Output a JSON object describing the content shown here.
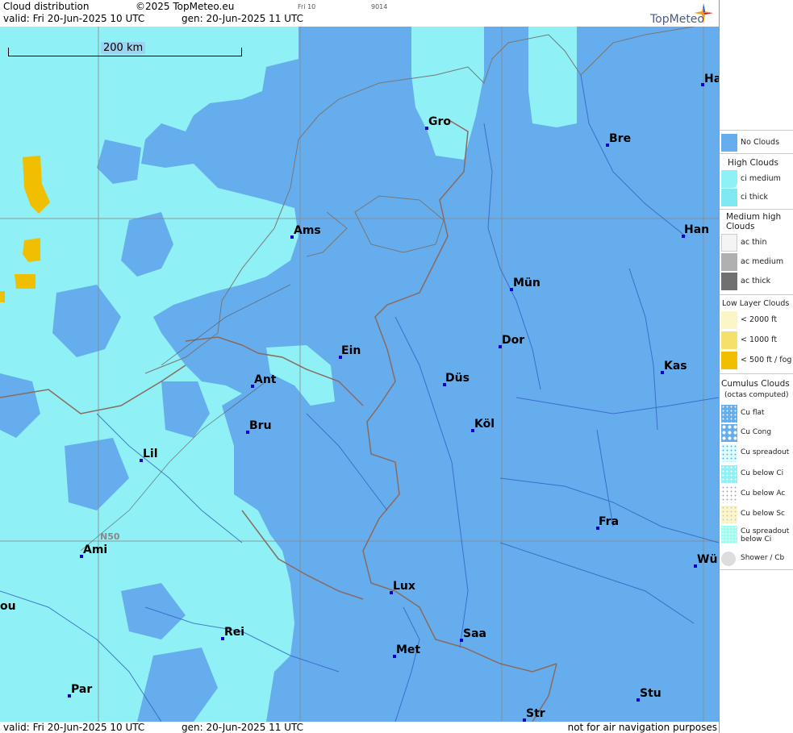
{
  "header": {
    "title": "Cloud distribution",
    "copyright": "©2025 TopMeteo.eu",
    "valid": "valid:  Fri  20-Jun-2025  10 UTC",
    "gen": "gen: 20-Jun-2025 11 UTC",
    "small1": "Fri 10",
    "small2": "9014",
    "logo": "TopMeteo"
  },
  "footer": {
    "valid": "valid:  Fri  20-Jun-2025  10 UTC",
    "gen": "gen: 20-Jun-2025 11 UTC",
    "note": "not for air navigation purposes"
  },
  "map": {
    "scale_label": "200 km",
    "lat_label": "N50",
    "cities": [
      {
        "name": "Ha"
      },
      {
        "name": "Gro"
      },
      {
        "name": "Bre"
      },
      {
        "name": "Ams"
      },
      {
        "name": "Han"
      },
      {
        "name": "Mün"
      },
      {
        "name": "Dor"
      },
      {
        "name": "Ein"
      },
      {
        "name": "Kas"
      },
      {
        "name": "Ant"
      },
      {
        "name": "Düs"
      },
      {
        "name": "Köl"
      },
      {
        "name": "Bru"
      },
      {
        "name": "Lil"
      },
      {
        "name": "Fra"
      },
      {
        "name": "Ami"
      },
      {
        "name": "Wü"
      },
      {
        "name": "Lux"
      },
      {
        "name": "ou"
      },
      {
        "name": "Rei"
      },
      {
        "name": "Saa"
      },
      {
        "name": "Met"
      },
      {
        "name": "Par"
      },
      {
        "name": "Stu"
      },
      {
        "name": "Str"
      }
    ]
  },
  "legend": {
    "no_clouds": "No Clouds",
    "high": "High Clouds",
    "ci_medium": "ci medium",
    "ci_thick": "ci thick",
    "medium_high": "Medium high Clouds",
    "ac_thin": "ac thin",
    "ac_medium": "ac medium",
    "ac_thick": "ac thick",
    "low": "Low Layer Clouds",
    "lt2000": "< 2000 ft",
    "lt1000": "< 1000 ft",
    "lt500": "< 500 ft / fog",
    "cumulus": "Cumulus Clouds",
    "octas": "(octas computed)",
    "cu_flat": "Cu flat",
    "cu_cong": "Cu Cong",
    "cu_spread": "Cu spreadout",
    "cu_below_ci": "Cu below Ci",
    "cu_below_ac": "Cu below Ac",
    "cu_below_sc": "Cu below Sc",
    "cu_spread_ci": "Cu spreadout below Ci",
    "shower": "Shower / Cb"
  },
  "colors": {
    "no_clouds": "#66adee",
    "ci_medium": "#8ff0f5",
    "ci_thick": "#7fe8f0",
    "low_fog": "#f0c000"
  }
}
